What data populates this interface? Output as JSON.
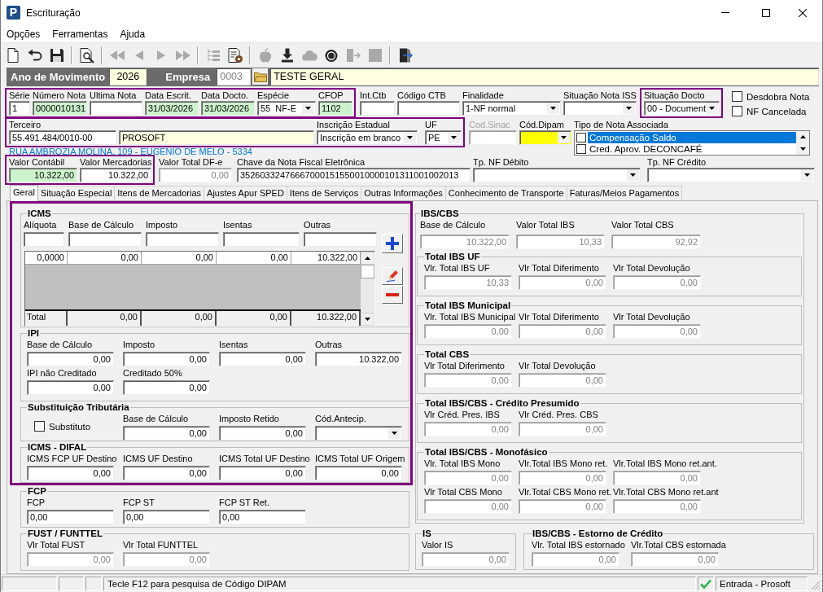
{
  "window": {
    "logo_text": "P",
    "title": "Escrituração"
  },
  "menu": [
    {
      "label": "Opções"
    },
    {
      "label": "Ferramentas"
    },
    {
      "label": "Ajuda"
    }
  ],
  "toolbar": [
    [
      {
        "kind": "page",
        "disabled": false
      },
      {
        "kind": "undo",
        "disabled": false
      },
      {
        "kind": "save",
        "disabled": false
      }
    ],
    [
      {
        "kind": "preview",
        "disabled": false
      }
    ],
    [
      {
        "kind": "first",
        "disabled": true
      },
      {
        "kind": "previous",
        "disabled": true
      },
      {
        "kind": "next",
        "disabled": true
      },
      {
        "kind": "last",
        "disabled": true
      }
    ],
    [
      {
        "kind": "tree",
        "disabled": true
      },
      {
        "kind": "report",
        "disabled": false
      }
    ],
    [
      {
        "kind": "apple",
        "disabled": true
      },
      {
        "kind": "download",
        "disabled": false
      },
      {
        "kind": "cloud",
        "disabled": true
      },
      {
        "kind": "coin",
        "disabled": false
      },
      {
        "kind": "split",
        "disabled": true
      },
      {
        "kind": "block",
        "disabled": true
      }
    ],
    [
      {
        "kind": "exit",
        "disabled": false
      }
    ]
  ],
  "header": {
    "year": {
      "label": "Ano de Movimento",
      "value": "2026",
      "color": "#ffffe1",
      "disabled": false
    },
    "company": {
      "label": "Empresa",
      "value": "0003",
      "disabled": true
    },
    "company_name": {
      "value": "TESTE GERAL",
      "color": "#ffffe1",
      "disabled": false
    }
  },
  "identification": {
    "groups": [
      {
        "highlighted": true,
        "fields": [
          {
            "label": "Série",
            "value": "1",
            "kind": "text",
            "disabled": false
          },
          {
            "label": "Número Nota",
            "value": "0000010131",
            "kind": "text",
            "color": "#cdf3cd",
            "disabled": false
          },
          {
            "label": "Ultima Nota",
            "kind": "text",
            "disabled": false
          },
          {
            "label": "Data Escrit.",
            "value": "31/03/2026",
            "kind": "text",
            "color": "#cdf3cd",
            "disabled": false
          },
          {
            "label": "Data Docto.",
            "value": "31/03/2026",
            "kind": "text",
            "color": "#cdf3cd",
            "disabled": false
          },
          {
            "label": "Espécie",
            "value": "55  NF-E",
            "kind": "combo",
            "disabled": false
          },
          {
            "label": "CFOP",
            "value": "1102",
            "kind": "text",
            "color": "#cdf3cd",
            "disabled": false
          }
        ]
      },
      {
        "highlighted": false,
        "fields": [
          {
            "label": "Int.Ctb",
            "kind": "text",
            "disabled": false
          },
          {
            "label": "Código CTB",
            "kind": "text",
            "disabled": false
          },
          {
            "label": "Finalidade",
            "value": "1-NF normal",
            "kind": "combo",
            "disabled": false
          },
          {
            "label": "Situação Nota ISS",
            "kind": "combo",
            "disabled": false
          }
        ]
      },
      {
        "highlighted": true,
        "fields": [
          {
            "label": "Situação Docto",
            "value": "00 - Document",
            "kind": "combo",
            "disabled": false
          }
        ]
      },
      {
        "highlighted": false,
        "checkboxes": [
          {
            "label": "Desdobra Nota",
            "checked": false
          },
          {
            "label": "NF Cancelada",
            "checked": false
          }
        ]
      }
    ]
  },
  "party": {
    "groups": [
      {
        "highlighted": true,
        "fields": [
          {
            "label": "Terceiro",
            "value": "55.491.484/0010-00",
            "kind": "text",
            "disabled": false
          },
          {
            "value": "PROSOFT",
            "kind": "text",
            "color": "#ffffe1",
            "disabled": false
          },
          {
            "label": "Inscrição Estadual",
            "value": "Inscrição em branco",
            "kind": "combo",
            "disabled": false
          },
          {
            "label": "UF",
            "value": "PE",
            "kind": "combo",
            "disabled": false
          }
        ]
      },
      {
        "highlighted": false,
        "fields": [
          {
            "label": "Cod.Sinac",
            "kind": "text",
            "disabled": true
          },
          {
            "label": "Cód.Dipam",
            "kind": "combo",
            "color": "#ffff00",
            "disabled": false
          },
          {
            "label": "Tipo de Nota Associada",
            "kind": "checklist",
            "disabled": false,
            "items": [
              {
                "label": "Compensação Saldo",
                "checked": false,
                "selected": true
              },
              {
                "label": "Cred. Aprov. DECONCAFÉ",
                "checked": false,
                "selected": false
              }
            ]
          }
        ]
      }
    ]
  },
  "address": "RUA AMBROZIA MOLINA, 109 - EUGENIO DE MELO - 5334",
  "values": {
    "groups": [
      {
        "highlighted": true,
        "fields": [
          {
            "label": "Valor Contábil",
            "value": "10.322,00",
            "kind": "number",
            "color": "#cdf3cd",
            "disabled": false
          },
          {
            "label": "Valor Mercadorias",
            "value": "10.322,00",
            "kind": "number",
            "disabled": false
          }
        ]
      },
      {
        "highlighted": false,
        "fields": [
          {
            "label": "Valor Total DF-e",
            "value": "0,00",
            "kind": "number",
            "disabled": true
          },
          {
            "label": "Chave da Nota Fiscal Eletrônica",
            "value": "35260332476667000151550010000101311001002013",
            "kind": "text",
            "disabled": false
          },
          {
            "label": "Tp. NF Débito",
            "kind": "combo",
            "disabled": false
          },
          {
            "label": "Tp. NF Crédito",
            "kind": "combo",
            "disabled": false
          }
        ]
      }
    ]
  },
  "tabs": [
    {
      "label": "Geral",
      "selected": true
    },
    {
      "label": "Situação Especial",
      "selected": false
    },
    {
      "label": "Itens de Mercadorias",
      "selected": false
    },
    {
      "label": "Ajustes Apur SPED",
      "selected": false
    },
    {
      "label": "Itens de Serviços",
      "selected": false
    },
    {
      "label": "Outras Informações",
      "selected": false
    },
    {
      "label": "Conhecimento de Transporte",
      "selected": false
    },
    {
      "label": "Faturas/Meios Pagamentos",
      "selected": false
    }
  ],
  "left_sections": [
    {
      "highlighted": true,
      "groups": [
        {
          "kind": "grid",
          "title": "ICMS",
          "columns": [
            "Alíquota",
            "Base de Cálculo",
            "Imposto",
            "Isentas",
            "Outras"
          ],
          "rows": [
            [
              "0,0000",
              "0,00",
              "0,00",
              "0,00",
              "10.322,00"
            ]
          ],
          "total_label": "Total",
          "totals": [
            "0,00",
            "0,00",
            "0,00",
            "10.322,00"
          ],
          "buttons": [
            {
              "kind": "add"
            },
            {
              "kind": "edit"
            },
            {
              "kind": "remove"
            }
          ]
        },
        {
          "kind": "fields",
          "title": "IPI",
          "rows": [
            [
              {
                "label": "Base de Cálculo",
                "value": "0,00",
                "kind": "number",
                "disabled": false
              },
              {
                "label": "Imposto",
                "value": "0,00",
                "kind": "number",
                "disabled": false
              },
              {
                "label": "Isentas",
                "value": "0,00",
                "kind": "number",
                "disabled": false
              },
              {
                "label": "Outras",
                "value": "10.322,00",
                "kind": "number",
                "disabled": false
              }
            ],
            [
              {
                "label": "IPI não Creditado",
                "value": "0,00",
                "kind": "number",
                "disabled": false
              },
              {
                "label": "Creditado 50%",
                "value": "0,00",
                "kind": "number",
                "disabled": false
              }
            ]
          ]
        },
        {
          "kind": "fields",
          "title": "Substituição Tributária",
          "rows": [
            [
              {
                "label": "Substituto",
                "kind": "checkbox",
                "checked": false,
                "disabled": false
              },
              {
                "label": "Base de Cálculo",
                "value": "0,00",
                "kind": "number",
                "disabled": false
              },
              {
                "label": "Imposto Retido",
                "value": "0,00",
                "kind": "number",
                "disabled": false
              },
              {
                "label": "Cód.Antecip.",
                "kind": "combo",
                "disabled": false
              }
            ]
          ]
        },
        {
          "kind": "fields",
          "title": "ICMS - DIFAL",
          "rows": [
            [
              {
                "label": "ICMS FCP UF Destino",
                "value": "0,00",
                "kind": "number",
                "disabled": false
              },
              {
                "label": "ICMS UF Destino",
                "value": "0,00",
                "kind": "number",
                "disabled": false
              },
              {
                "label": "ICMS Total UF Destino",
                "value": "0,00",
                "kind": "number",
                "disabled": false
              },
              {
                "label": "ICMS Total UF Origem",
                "value": "0,00",
                "kind": "number",
                "disabled": false
              }
            ]
          ]
        }
      ]
    },
    {
      "highlighted": false,
      "groups": [
        {
          "kind": "fields",
          "title": "FCP",
          "rows": [
            [
              {
                "label": "FCP",
                "value": "0,00",
                "kind": "text",
                "disabled": false
              },
              {
                "label": "FCP ST",
                "value": "0,00",
                "kind": "text",
                "disabled": false
              },
              {
                "label": "FCP ST Ret.",
                "value": "0,00",
                "kind": "text",
                "disabled": false
              }
            ]
          ]
        },
        {
          "kind": "fields",
          "title": "FUST / FUNTTEL",
          "rows": [
            [
              {
                "label": "Vlr Total FUST",
                "value": "0,00",
                "kind": "number",
                "disabled": true
              },
              {
                "label": "Vlr Total FUNTTEL",
                "value": "0,00",
                "kind": "number",
                "disabled": true
              }
            ]
          ]
        }
      ]
    }
  ],
  "ibs_cbs": {
    "title": "IBS/CBS",
    "rows": [
      [
        {
          "label": "Base de Cálculo",
          "value": "10.322,00",
          "kind": "number",
          "disabled": true
        },
        {
          "label": "Valor Total IBS",
          "value": "10,33",
          "kind": "number",
          "disabled": true
        },
        {
          "label": "Valor Total CBS",
          "value": "92,92",
          "kind": "number",
          "disabled": true
        }
      ]
    ],
    "groups": [
      {
        "title": "Total IBS UF",
        "rows": [
          [
            {
              "label": "Vlr. Total IBS UF",
              "value": "10,33",
              "kind": "number",
              "disabled": true
            },
            {
              "label": "Vlr Total Diferimento",
              "value": "0,00",
              "kind": "number",
              "disabled": true
            },
            {
              "label": "Vlr Total Devolução",
              "value": "0,00",
              "kind": "number",
              "disabled": true
            }
          ]
        ]
      },
      {
        "title": "Total IBS Municipal",
        "rows": [
          [
            {
              "label": "Vlr. Total IBS Municipal",
              "value": "0,00",
              "kind": "number",
              "disabled": true
            },
            {
              "label": "Vlr Total Diferimento",
              "value": "0,00",
              "kind": "number",
              "disabled": true
            },
            {
              "label": "Vlr Total Devolução",
              "value": "0,00",
              "kind": "number",
              "disabled": true
            }
          ]
        ]
      },
      {
        "title": "Total CBS",
        "rows": [
          [
            {
              "label": "Vlr Total Diferimento",
              "value": "0,00",
              "kind": "number",
              "disabled": true
            },
            {
              "label": "Vlr Total Devolução",
              "value": "0,00",
              "kind": "number",
              "disabled": true
            }
          ]
        ]
      },
      {
        "title": "Total IBS/CBS - Crédito Presumido",
        "rows": [
          [
            {
              "label": "Vlr Créd. Pres. IBS",
              "value": "0,00",
              "kind": "number",
              "disabled": true
            },
            {
              "label": "Vlr Créd. Pres. CBS",
              "value": "0,00",
              "kind": "number",
              "disabled": true
            }
          ]
        ]
      },
      {
        "title": "Total IBS/CBS - Monofásico",
        "rows": [
          [
            {
              "label": "Vlr. Total IBS Mono",
              "value": "0,00",
              "kind": "number",
              "disabled": true
            },
            {
              "label": "Vlr.Total IBS Mono ret.",
              "value": "0,00",
              "kind": "number",
              "disabled": true
            },
            {
              "label": "Vlr.Total IBS Mono ret.ant.",
              "value": "0,00",
              "kind": "number",
              "disabled": true
            }
          ],
          [
            {
              "label": "Vlr Total CBS Mono",
              "value": "0,00",
              "kind": "number",
              "disabled": true
            },
            {
              "label": "Vlr.Total CBS Mono ret.",
              "value": "0,00",
              "kind": "number",
              "disabled": true
            },
            {
              "label": "Vlr.Total CBS Mono ret.ant",
              "value": "0,00",
              "kind": "number",
              "disabled": true
            }
          ]
        ]
      }
    ]
  },
  "bottom_groups": [
    {
      "title": "IS",
      "rows": [
        [
          {
            "label": "Valor IS",
            "value": "0,00",
            "kind": "number",
            "disabled": true
          }
        ]
      ]
    },
    {
      "title": "IBS/CBS - Estorno de Crédito",
      "rows": [
        [
          {
            "label": "Vlr. Total IBS estornado",
            "value": "0,00",
            "kind": "number",
            "disabled": true
          },
          {
            "label": "Vlr.Total CBS estornada",
            "value": "0,00",
            "kind": "number",
            "disabled": true
          }
        ]
      ]
    }
  ],
  "status_bar": {
    "message": "Tecle F12 para pesquisa de Código DIPAM",
    "mode": "Entrada - Prosoft"
  }
}
